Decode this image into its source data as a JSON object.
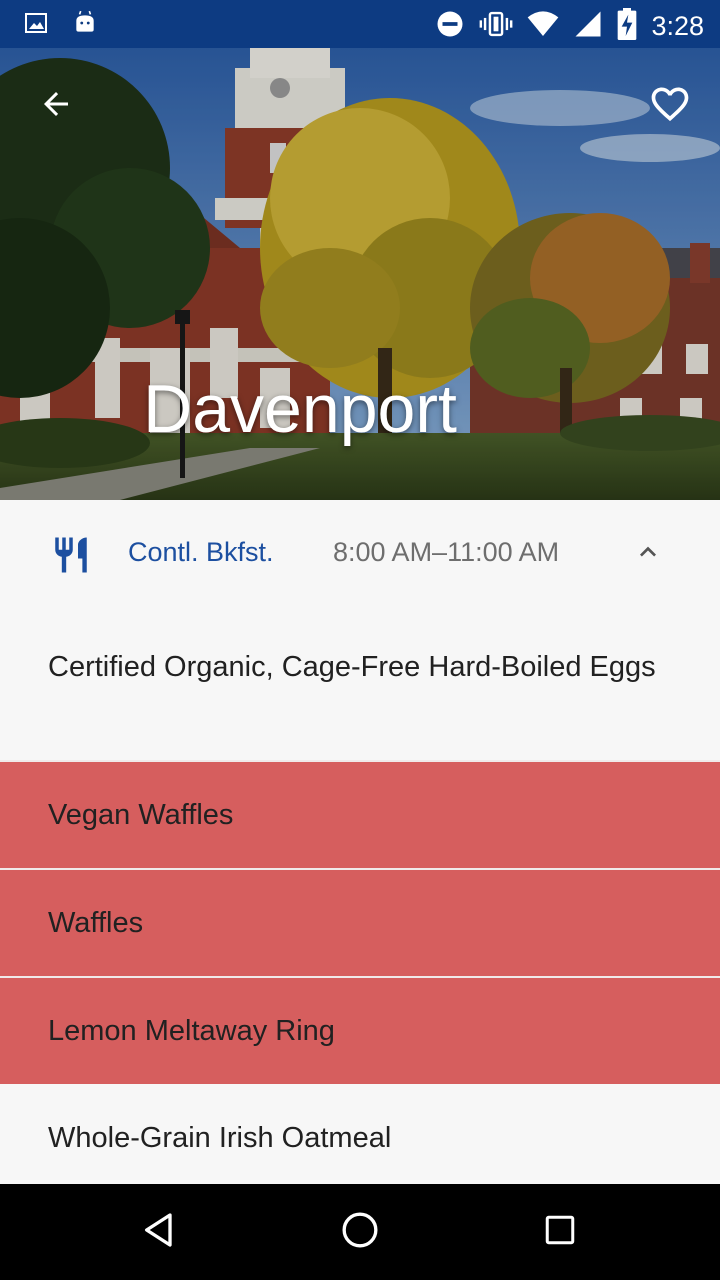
{
  "status_bar": {
    "time": "3:28",
    "left_icons": [
      "image-icon",
      "android-icon"
    ],
    "right_icons": [
      "dnd-icon",
      "vibrate-icon",
      "wifi-icon",
      "signal-icon",
      "battery-charging-icon"
    ]
  },
  "hero": {
    "title": "Davenport",
    "back_icon": "arrow-back-icon",
    "favorite_icon": "heart-outline-icon"
  },
  "meal": {
    "icon": "restaurant-icon",
    "name": "Contl. Bkfst.",
    "hours": "8:00 AM–11:00 AM",
    "toggle_icon": "chevron-up-icon"
  },
  "menu_items": [
    {
      "label": "Certified Organic, Cage-Free Hard-Boiled Eggs",
      "highlighted": false
    },
    {
      "label": "Vegan Waffles",
      "highlighted": true
    },
    {
      "label": "Waffles",
      "highlighted": true
    },
    {
      "label": "Lemon Meltaway Ring",
      "highlighted": true
    },
    {
      "label": "Whole-Grain Irish Oatmeal",
      "highlighted": false
    }
  ],
  "colors": {
    "status_bar": "#0d3b82",
    "accent": "#1c4fa0",
    "highlight": "#d65e5e",
    "background": "#f7f7f7"
  },
  "nav_bar": {
    "back_icon": "nav-back-icon",
    "home_icon": "nav-home-icon",
    "recents_icon": "nav-recents-icon"
  }
}
